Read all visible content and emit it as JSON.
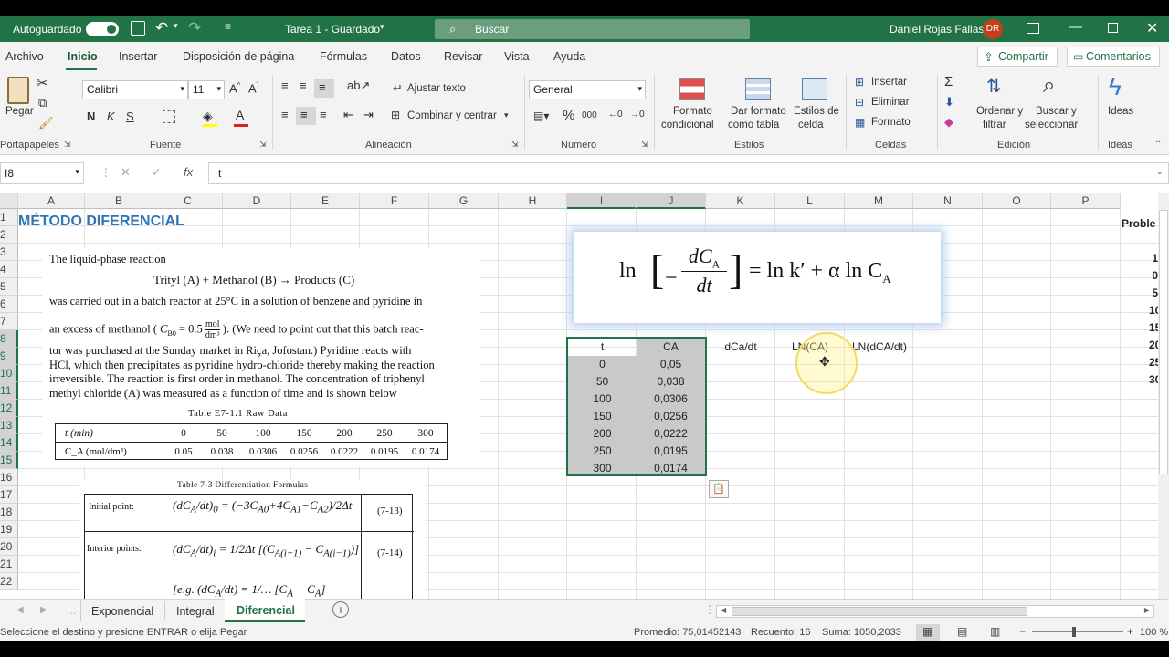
{
  "titlebar": {
    "autosave": "Autoguardado",
    "doc_title": "Tarea 1 - Guardado",
    "search_placeholder": "Buscar",
    "user": "Daniel Rojas Fallas",
    "initials": "DR"
  },
  "menu": [
    "Archivo",
    "Inicio",
    "Insertar",
    "Disposición de página",
    "Fórmulas",
    "Datos",
    "Revisar",
    "Vista",
    "Ayuda"
  ],
  "actions": {
    "share": "Compartir",
    "comments": "Comentarios"
  },
  "ribbon": {
    "paste": "Pegar",
    "clipboard": "Portapapeles",
    "font_name": "Calibri",
    "font_size": "11",
    "font_group": "Fuente",
    "bold": "N",
    "italic": "K",
    "underline": "S",
    "wrap": "Ajustar texto",
    "merge": "Combinar y centrar",
    "align_group": "Alineación",
    "number_format": "General",
    "number_group": "Número",
    "cond_format_1": "Formato",
    "cond_format_2": "condicional",
    "table_format_1": "Dar formato",
    "table_format_2": "como tabla",
    "cell_styles_1": "Estilos de",
    "cell_styles_2": "celda",
    "styles_group": "Estilos",
    "insert": "Insertar",
    "delete": "Eliminar",
    "format": "Formato",
    "cells_group": "Celdas",
    "sort_1": "Ordenar y",
    "sort_2": "filtrar",
    "find_1": "Buscar y",
    "find_2": "seleccionar",
    "editing_group": "Edición",
    "ideas": "Ideas",
    "ideas_group": "Ideas"
  },
  "formula_bar": {
    "name_box": "I8",
    "formula": "t"
  },
  "columns": [
    "A",
    "B",
    "C",
    "D",
    "E",
    "F",
    "G",
    "H",
    "I",
    "J",
    "K",
    "L",
    "M",
    "N",
    "O",
    "P"
  ],
  "rows": [
    "1",
    "2",
    "3",
    "4",
    "5",
    "6",
    "7",
    "8",
    "9",
    "10",
    "11",
    "12",
    "13",
    "14",
    "15",
    "16",
    "17",
    "18",
    "19",
    "20",
    "21",
    "22"
  ],
  "sheet": {
    "title": "MÉTODO DIFERENCIAL",
    "problem_label": "Proble",
    "headers": [
      "t",
      "CA",
      "dCa/dt",
      "LN(CA)",
      "LN(dCA/dt)"
    ],
    "table": [
      [
        "0",
        "0,05"
      ],
      [
        "50",
        "0,038"
      ],
      [
        "100",
        "0,0306"
      ],
      [
        "150",
        "0,0256"
      ],
      [
        "200",
        "0,0222"
      ],
      [
        "250",
        "0,0195"
      ],
      [
        "300",
        "0,0174"
      ]
    ],
    "right_edge_values": [
      "1",
      "0",
      "5",
      "10",
      "15",
      "20",
      "25",
      "30"
    ]
  },
  "textbook": {
    "p1": "The liquid-phase reaction",
    "p2": "Trityl (A) + Methanol (B) → Products (C)",
    "p3": "was carried out in a batch reactor at 25°C in a solution of benzene and pyridine in",
    "p4a": "an excess of methanol (",
    "p4b": "C",
    "p4c": "B0",
    "p4d": "= 0.5",
    "p4e": "mol",
    "p4f": "dm³",
    "p4g": "). (We need to point out that this batch reac-",
    "p5": "tor was purchased at the Sunday market in Riça, Jofostan.) Pyridine reacts with",
    "p6": "HCl, which then precipitates as pyridine hydro-chloride thereby making the reaction",
    "p7": "irreversible. The reaction is first order in methanol. The concentration of triphenyl",
    "p8": "methyl chloride (A) was measured as a function of time and is shown below",
    "table_title": "Table E7-1.1    Raw Data",
    "t_label": "t (min)",
    "t_values": [
      "0",
      "50",
      "100",
      "150",
      "200",
      "250",
      "300"
    ],
    "ca_label": "C_A (mol/dm³)",
    "ca_values": [
      "0.05",
      "0.038",
      "0.0306",
      "0.0256",
      "0.0222",
      "0.0195",
      "0.0174"
    ],
    "diff_title": "Table 7-3   Differentiation Formulas",
    "initial": "Initial point:",
    "interior": "Interior points:",
    "eq1": "(7-13)",
    "eq2": "(7-14)"
  },
  "equation": {
    "ln": "ln",
    "rhs": "= ln k′ + α ln C",
    "sub": "A",
    "num": "dC",
    "den": "dt"
  },
  "tabs": [
    "Exponencial",
    "Integral",
    "Diferencial"
  ],
  "status": {
    "message": "Seleccione el destino y presione ENTRAR o elija Pegar",
    "average": "Promedio: 75,01452143",
    "count": "Recuento: 16",
    "sum": "Suma: 1050,2033",
    "zoom": "100 %"
  }
}
